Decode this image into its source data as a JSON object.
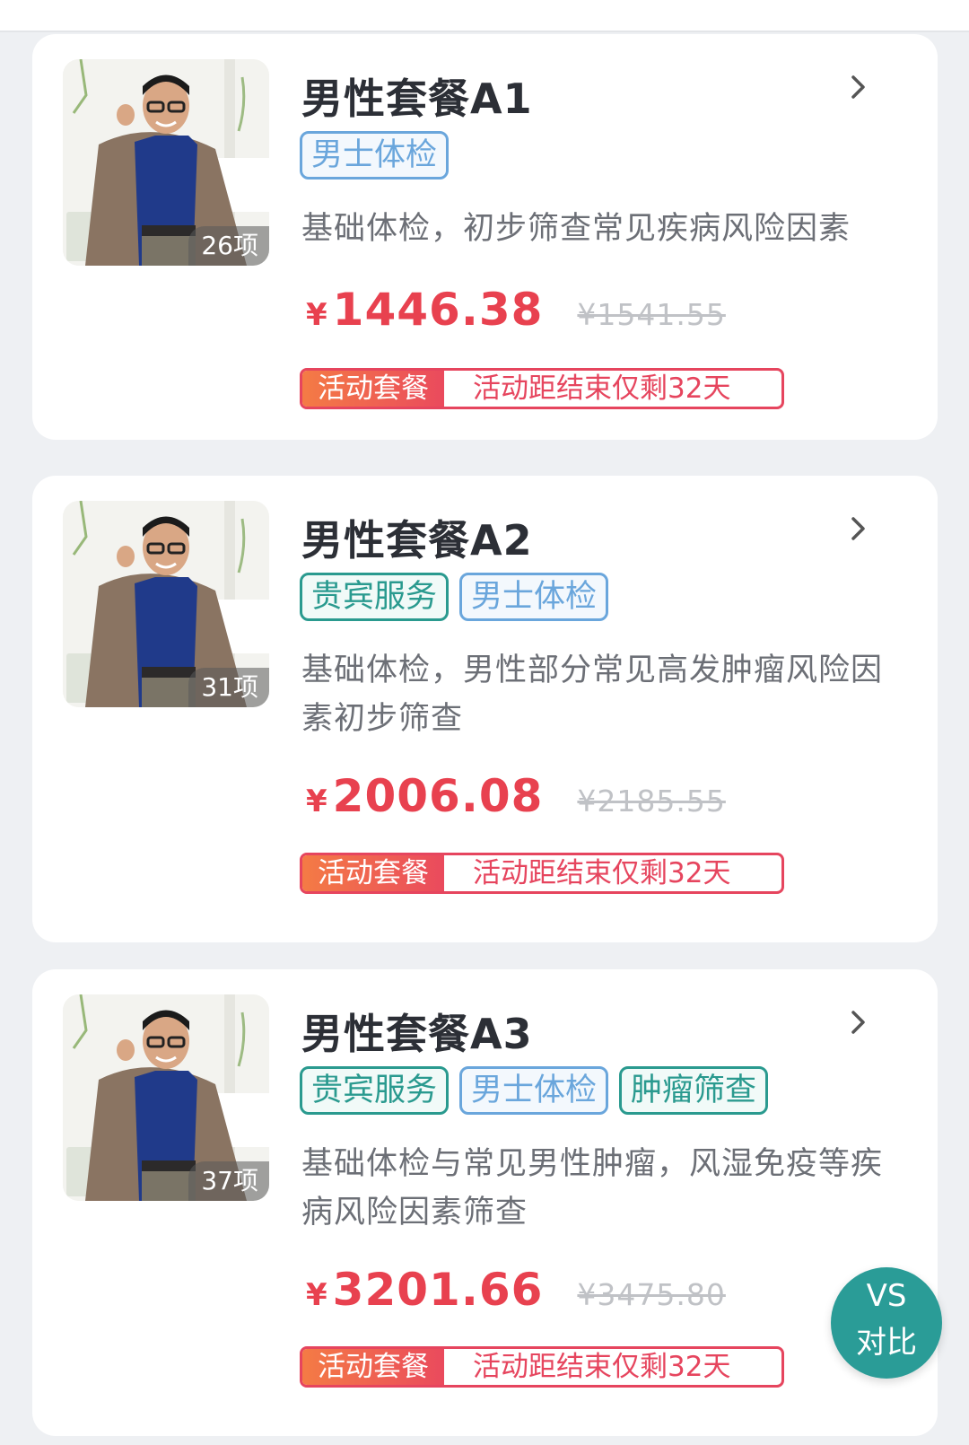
{
  "packages": [
    {
      "title": "男性套餐A1",
      "count": "26项",
      "tags": [
        {
          "label": "男士体检",
          "color": "#6aa6dc",
          "bg": "#f3f8fd"
        }
      ],
      "desc": "基础体检，初步筛查常见疾病风险因素",
      "price_symbol": "¥",
      "price": "1446.38",
      "original_price": "¥1541.55",
      "promo_label": "活动套餐",
      "promo_text": "活动距结束仅剩32天"
    },
    {
      "title": "男性套餐A2",
      "count": "31项",
      "tags": [
        {
          "label": "贵宾服务",
          "color": "#2a9a8f",
          "bg": "#f1faf8"
        },
        {
          "label": "男士体检",
          "color": "#6aa6dc",
          "bg": "#f3f8fd"
        }
      ],
      "desc": "基础体检，男性部分常见高发肿瘤风险因素初步筛查",
      "price_symbol": "¥",
      "price": "2006.08",
      "original_price": "¥2185.55",
      "promo_label": "活动套餐",
      "promo_text": "活动距结束仅剩32天"
    },
    {
      "title": "男性套餐A3",
      "count": "37项",
      "tags": [
        {
          "label": "贵宾服务",
          "color": "#2a9a8f",
          "bg": "#f1faf8"
        },
        {
          "label": "男士体检",
          "color": "#6aa6dc",
          "bg": "#f3f8fd"
        },
        {
          "label": "肿瘤筛查",
          "color": "#2a9a8f",
          "bg": "#f1faf8"
        }
      ],
      "desc": "基础体检与常见男性肿瘤，风湿免疫等疾病风险因素筛查",
      "price_symbol": "¥",
      "price": "3201.66",
      "original_price": "¥3475.80",
      "promo_label": "活动套餐",
      "promo_text": "活动距结束仅剩32天"
    }
  ],
  "compare_button": {
    "line1": "VS",
    "line2": "对比"
  },
  "colors": {
    "price": "#e8414f",
    "promo_border": "#e6455e",
    "vs_button": "#2a9c97"
  },
  "icons": [
    "chevron-right-icon"
  ]
}
